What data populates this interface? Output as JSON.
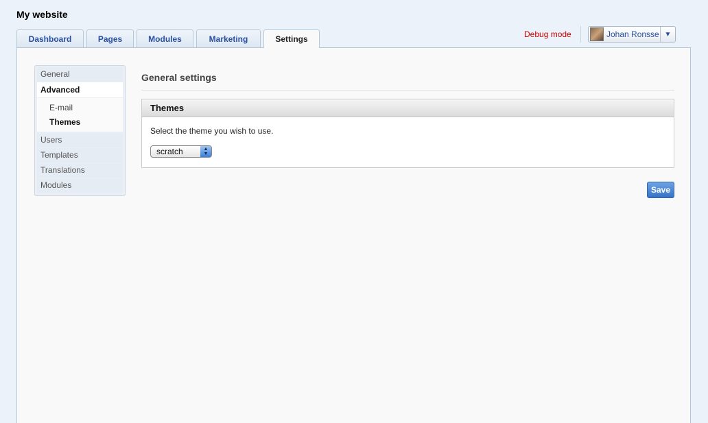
{
  "header": {
    "site_title": "My website",
    "debug_label": "Debug mode",
    "user_name": "Johan Ronsse",
    "user_menu_arrow": "▼"
  },
  "tabs": [
    {
      "label": "Dashboard"
    },
    {
      "label": "Pages"
    },
    {
      "label": "Modules"
    },
    {
      "label": "Marketing"
    },
    {
      "label": "Settings",
      "active": true
    }
  ],
  "subnav": {
    "items": [
      {
        "label": "General"
      },
      {
        "label": "Advanced",
        "active": true
      },
      {
        "label": "Users"
      },
      {
        "label": "Templates"
      },
      {
        "label": "Translations"
      },
      {
        "label": "Modules"
      }
    ],
    "advanced_children": [
      {
        "label": "E-mail"
      },
      {
        "label": "Themes",
        "active": true
      }
    ]
  },
  "main": {
    "heading": "General settings",
    "box_title": "Themes",
    "box_text": "Select the theme you wish to use.",
    "theme_select_value": "scratch",
    "save_label": "Save"
  },
  "colors": {
    "accent": "#2a4fa0",
    "debug": "#d00000",
    "save_button": "#3673c6"
  }
}
